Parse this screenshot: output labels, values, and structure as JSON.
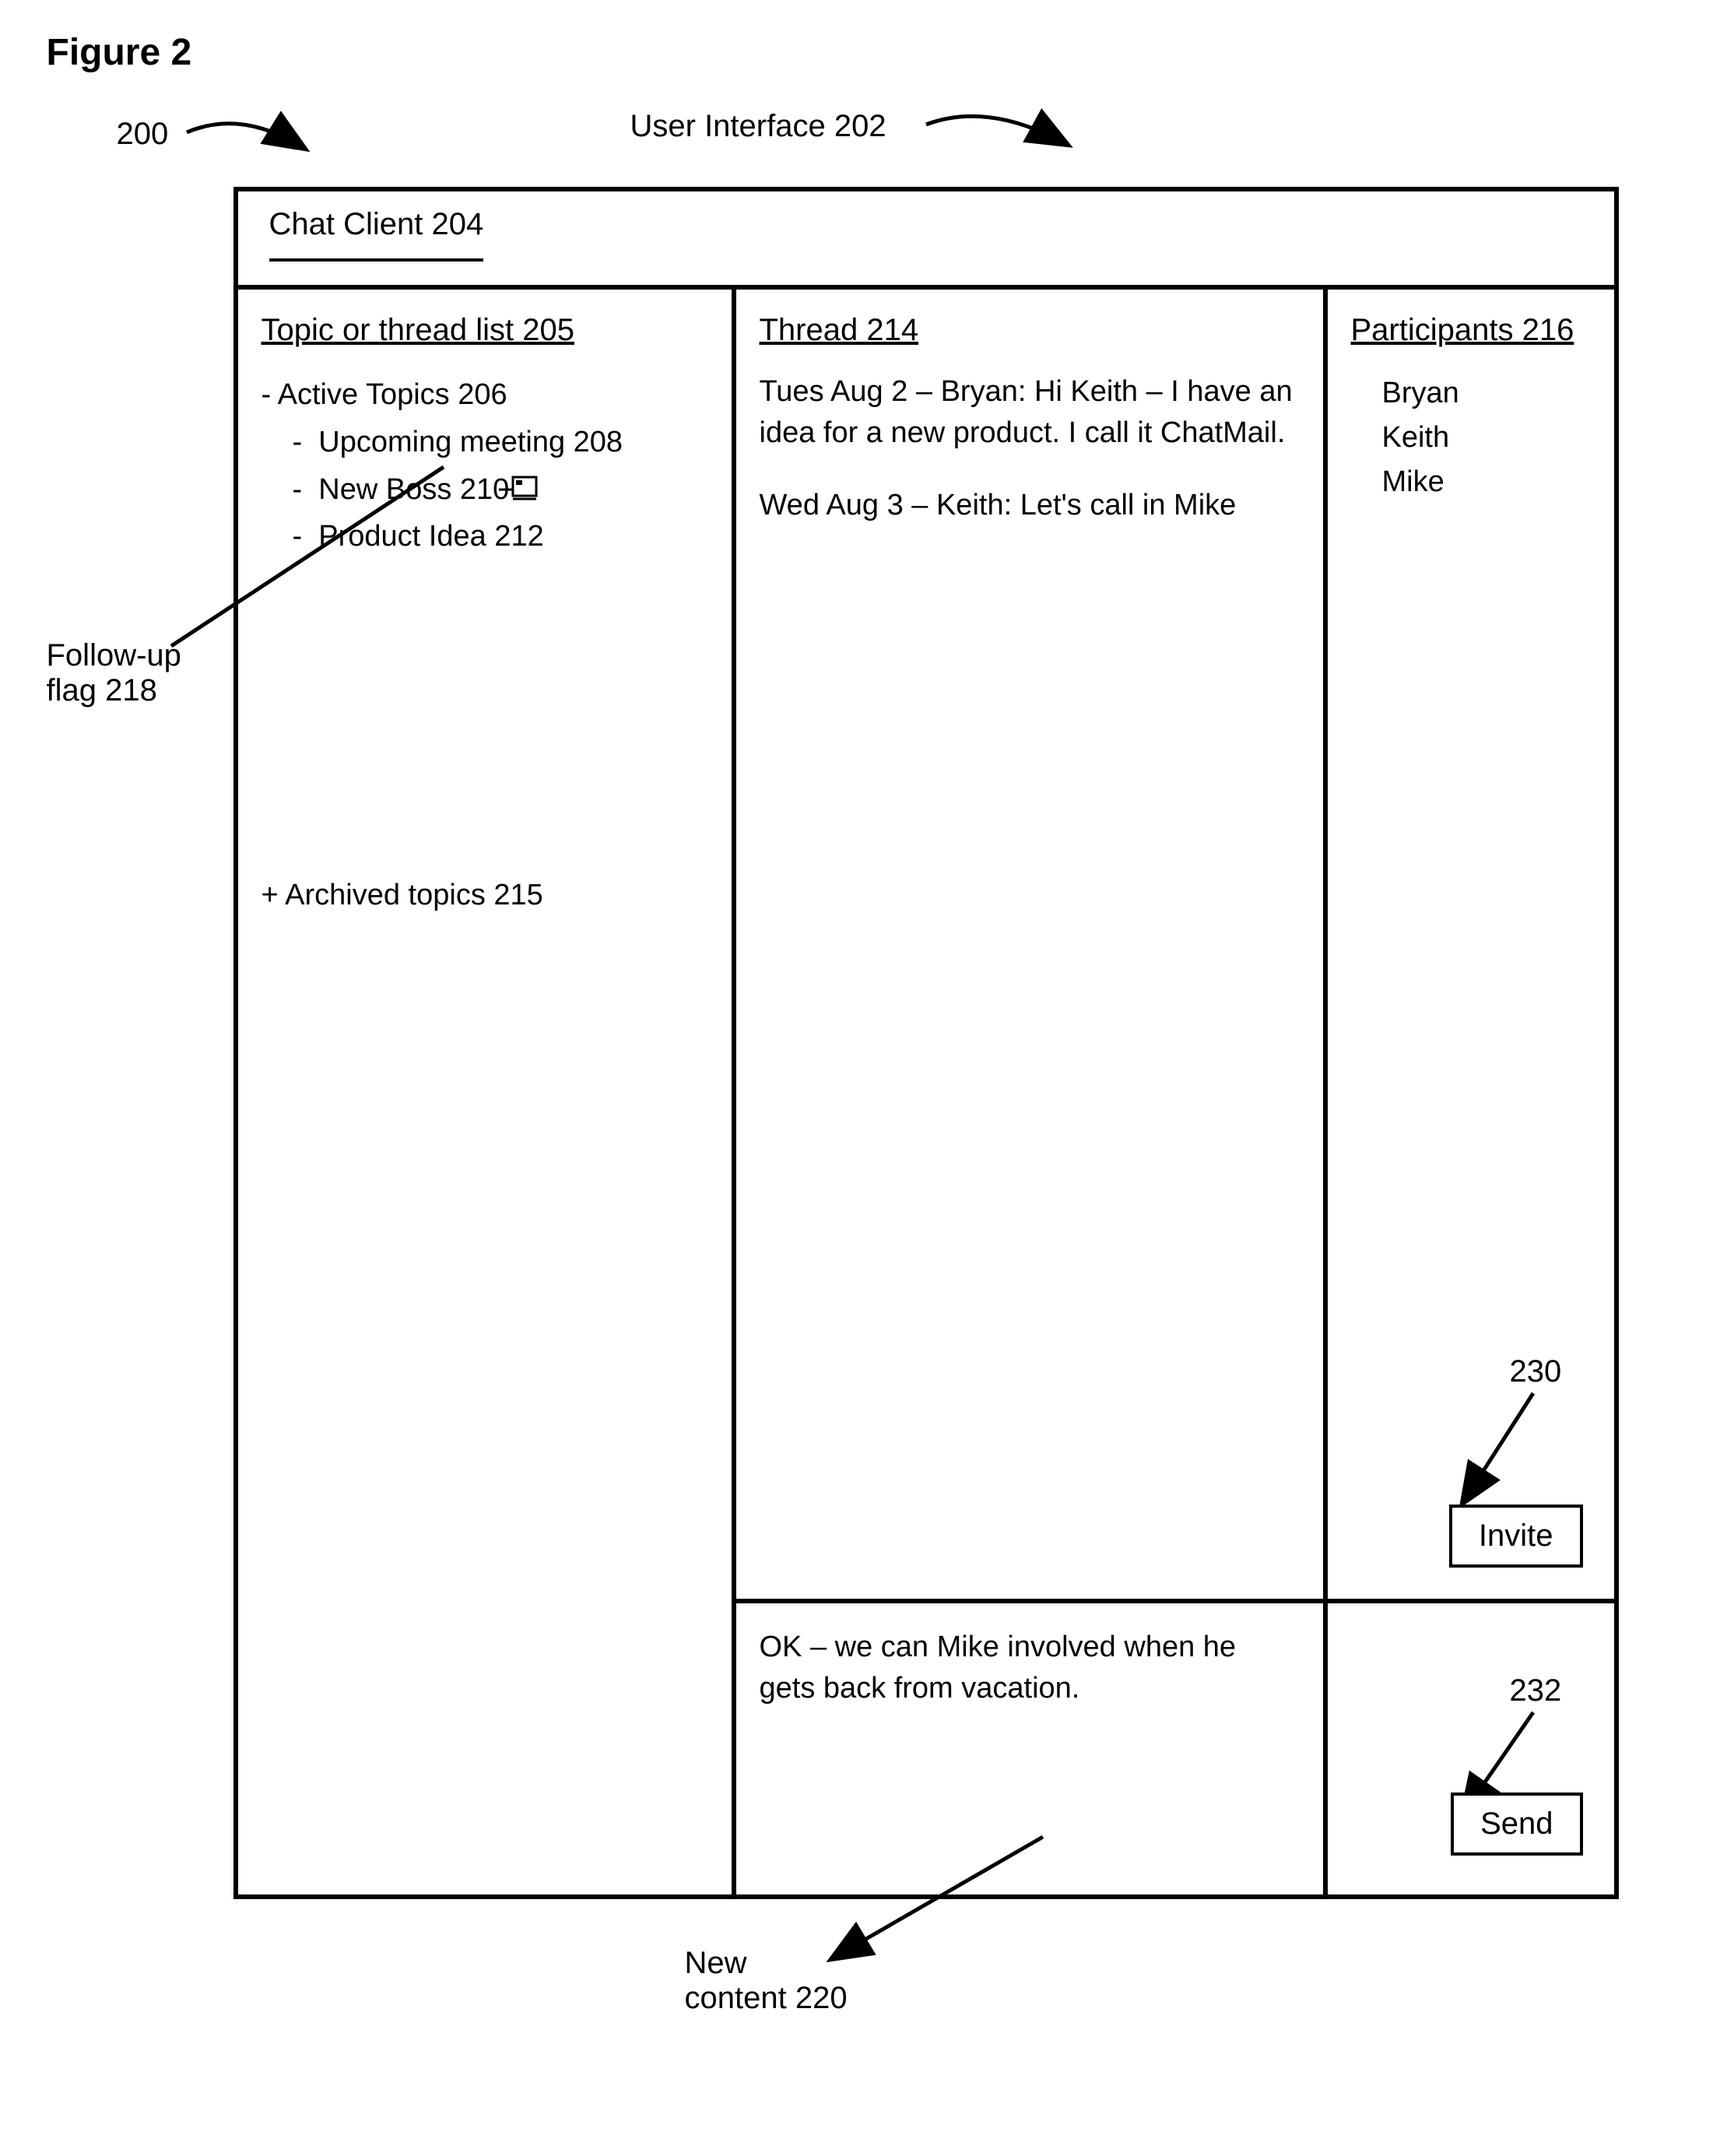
{
  "figure_title": "Figure 2",
  "refs": {
    "r200": "200",
    "ui_label": "User Interface 202",
    "chat_client": "Chat Client 204",
    "followup": "Follow-up flag 218",
    "newcontent": "New content 220",
    "r230": "230",
    "r232": "232"
  },
  "left": {
    "header": "Topic or thread list 205",
    "active": "- Active Topics 206",
    "upcoming": "Upcoming meeting 208",
    "newboss": "New Boss 210",
    "product": "Product Idea 212",
    "archived": "+ Archived topics 215"
  },
  "thread": {
    "header": "Thread 214",
    "msg1": "Tues Aug 2 – Bryan:  Hi Keith – I have an idea for a new product.  I call it ChatMail.",
    "msg2": "Wed Aug 3 – Keith:  Let's call in Mike"
  },
  "participants": {
    "header": "Participants 216",
    "p1": "Bryan",
    "p2": "Keith",
    "p3": "Mike",
    "invite": "Invite"
  },
  "compose": {
    "text": "OK – we can Mike involved when he gets back from vacation.",
    "send": "Send"
  }
}
